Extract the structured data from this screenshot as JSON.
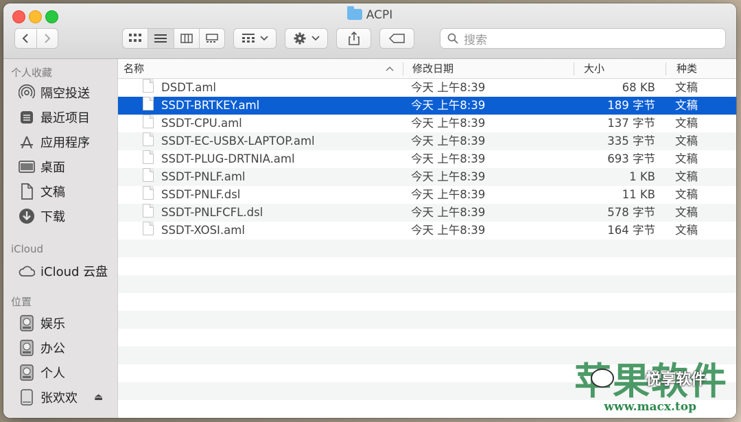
{
  "window": {
    "title": "ACPI"
  },
  "search": {
    "placeholder": "搜索"
  },
  "sidebar": {
    "favorites_heading": "个人收藏",
    "favorites": [
      {
        "label": "隔空投送",
        "icon": "airdrop-icon"
      },
      {
        "label": "最近项目",
        "icon": "recents-icon"
      },
      {
        "label": "应用程序",
        "icon": "applications-icon"
      },
      {
        "label": "桌面",
        "icon": "desktop-icon"
      },
      {
        "label": "文稿",
        "icon": "documents-icon"
      },
      {
        "label": "下载",
        "icon": "downloads-icon"
      }
    ],
    "icloud_heading": "iCloud",
    "icloud": [
      {
        "label": "iCloud 云盘",
        "icon": "cloud-icon"
      }
    ],
    "locations_heading": "位置",
    "locations": [
      {
        "label": "娱乐",
        "icon": "disk-icon"
      },
      {
        "label": "办公",
        "icon": "disk-icon"
      },
      {
        "label": "个人",
        "icon": "disk-icon"
      },
      {
        "label": "张欢欢",
        "icon": "external-disk-icon",
        "eject": "⏏"
      }
    ]
  },
  "columns": {
    "name": "名称",
    "date": "修改日期",
    "size": "大小",
    "kind": "种类"
  },
  "files": [
    {
      "name": "DSDT.aml",
      "date": "今天 上午8:39",
      "size": "68 KB",
      "kind": "文稿"
    },
    {
      "name": "SSDT-BRTKEY.aml",
      "date": "今天 上午8:39",
      "size": "189 字节",
      "kind": "文稿",
      "selected": true
    },
    {
      "name": "SSDT-CPU.aml",
      "date": "今天 上午8:39",
      "size": "137 字节",
      "kind": "文稿"
    },
    {
      "name": "SSDT-EC-USBX-LAPTOP.aml",
      "date": "今天 上午8:39",
      "size": "335 字节",
      "kind": "文稿"
    },
    {
      "name": "SSDT-PLUG-DRTNIA.aml",
      "date": "今天 上午8:39",
      "size": "693 字节",
      "kind": "文稿"
    },
    {
      "name": "SSDT-PNLF.aml",
      "date": "今天 上午8:39",
      "size": "1 KB",
      "kind": "文稿"
    },
    {
      "name": "SSDT-PNLF.dsl",
      "date": "今天 上午8:39",
      "size": "11 KB",
      "kind": "文稿"
    },
    {
      "name": "SSDT-PNLFCFL.dsl",
      "date": "今天 上午8:39",
      "size": "578 字节",
      "kind": "文稿"
    },
    {
      "name": "SSDT-XOSI.aml",
      "date": "今天 上午8:39",
      "size": "164 字节",
      "kind": "文稿"
    }
  ],
  "watermark": {
    "big": "苹果软件",
    "mid": "悦享软件",
    "url": "www.macx.top"
  },
  "colors": {
    "selection": "#0c5fd3",
    "stripe": "#f4f5f5",
    "sidebar": "#e4e2e2"
  }
}
